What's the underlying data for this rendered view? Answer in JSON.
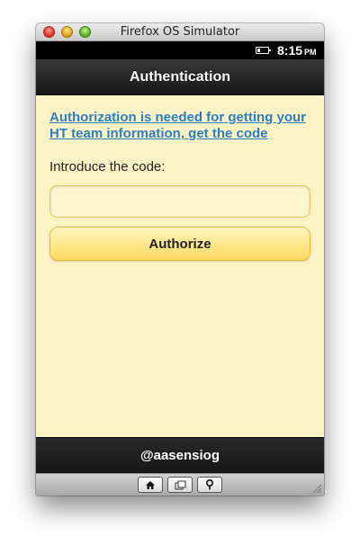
{
  "window": {
    "title": "Firefox OS Simulator"
  },
  "statusbar": {
    "time": "8:15",
    "ampm": "PM",
    "battery_icon": "battery-icon"
  },
  "header": {
    "title": "Authentication"
  },
  "content": {
    "auth_link": "Authorization is needed for getting your HT team information, get the code",
    "code_label": "Introduce the code:",
    "code_input_value": "",
    "authorize_label": "Authorize"
  },
  "footer": {
    "text": "@aasensiog"
  },
  "simulator_controls": {
    "icons": [
      "home-icon",
      "windows-icon",
      "location-pin-icon"
    ]
  },
  "colors": {
    "content_background": "#fdf3c4",
    "link": "#2b7fc5",
    "button_gradient_top": "#fff5bf",
    "button_gradient_bottom": "#ffd95e",
    "bar_background": "#1a1a1a"
  }
}
